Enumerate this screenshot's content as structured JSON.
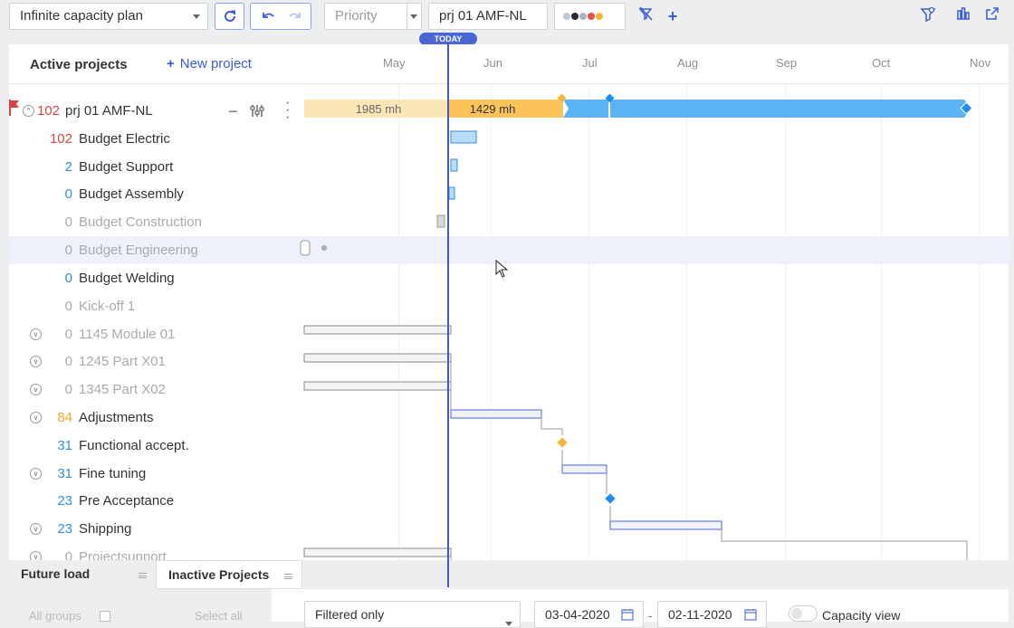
{
  "toolbar": {
    "plan_select": "Infinite capacity plan",
    "priority_placeholder": "Priority",
    "project_search": "prj 01 AMF-NL",
    "status_dot_colors": [
      "#b9c7d6",
      "#2a2a2a",
      "#a6b4c2",
      "#e64f4f",
      "#f2b63a"
    ]
  },
  "header": {
    "title": "Active projects",
    "new_project": "New project",
    "months": [
      "May",
      "Jun",
      "Jul",
      "Aug",
      "Sep",
      "Oct",
      "Nov"
    ],
    "today": "TODAY"
  },
  "project": {
    "count": "102",
    "name": "prj 01 AMF-NL",
    "past_hours": "1985 mh",
    "current_hours": "1429 mh"
  },
  "rows": [
    {
      "num": "102",
      "name": "Budget Electric"
    },
    {
      "num": "2",
      "name": "Budget Support"
    },
    {
      "num": "0",
      "name": "Budget Assembly"
    },
    {
      "num": "0",
      "name": "Budget Construction"
    },
    {
      "num": "0",
      "name": "Budget Engineering"
    },
    {
      "num": "0",
      "name": "Budget Welding"
    },
    {
      "num": "0",
      "name": "Kick-off 1"
    },
    {
      "num": "0",
      "name": "1145 Module 01"
    },
    {
      "num": "0",
      "name": "1245 Part X01"
    },
    {
      "num": "0",
      "name": "1345 Part X02"
    },
    {
      "num": "84",
      "name": "Adjustments"
    },
    {
      "num": "31",
      "name": "Functional accept."
    },
    {
      "num": "31",
      "name": "Fine tuning"
    },
    {
      "num": "23",
      "name": "Pre Acceptance"
    },
    {
      "num": "23",
      "name": "Shipping"
    },
    {
      "num": "0",
      "name": "Projectsupport"
    }
  ],
  "tabs": {
    "future_load": "Future load",
    "inactive_projects": "Inactive Projects"
  },
  "bottom": {
    "all_groups": "All groups",
    "select_all": "Select all",
    "filter": "Filtered only",
    "date_from": "03-04-2020",
    "date_to": "02-11-2020",
    "capacity_view": "Capacity view"
  },
  "colors": {
    "accent": "#3a5bd9",
    "today": "#4159d0",
    "bar_past": "#fbe7b5",
    "bar_current": "#fbc35a",
    "bar_future": "#5db4f5",
    "milestone_orange": "#f4b63a",
    "milestone_blue": "#1e8ef0"
  }
}
